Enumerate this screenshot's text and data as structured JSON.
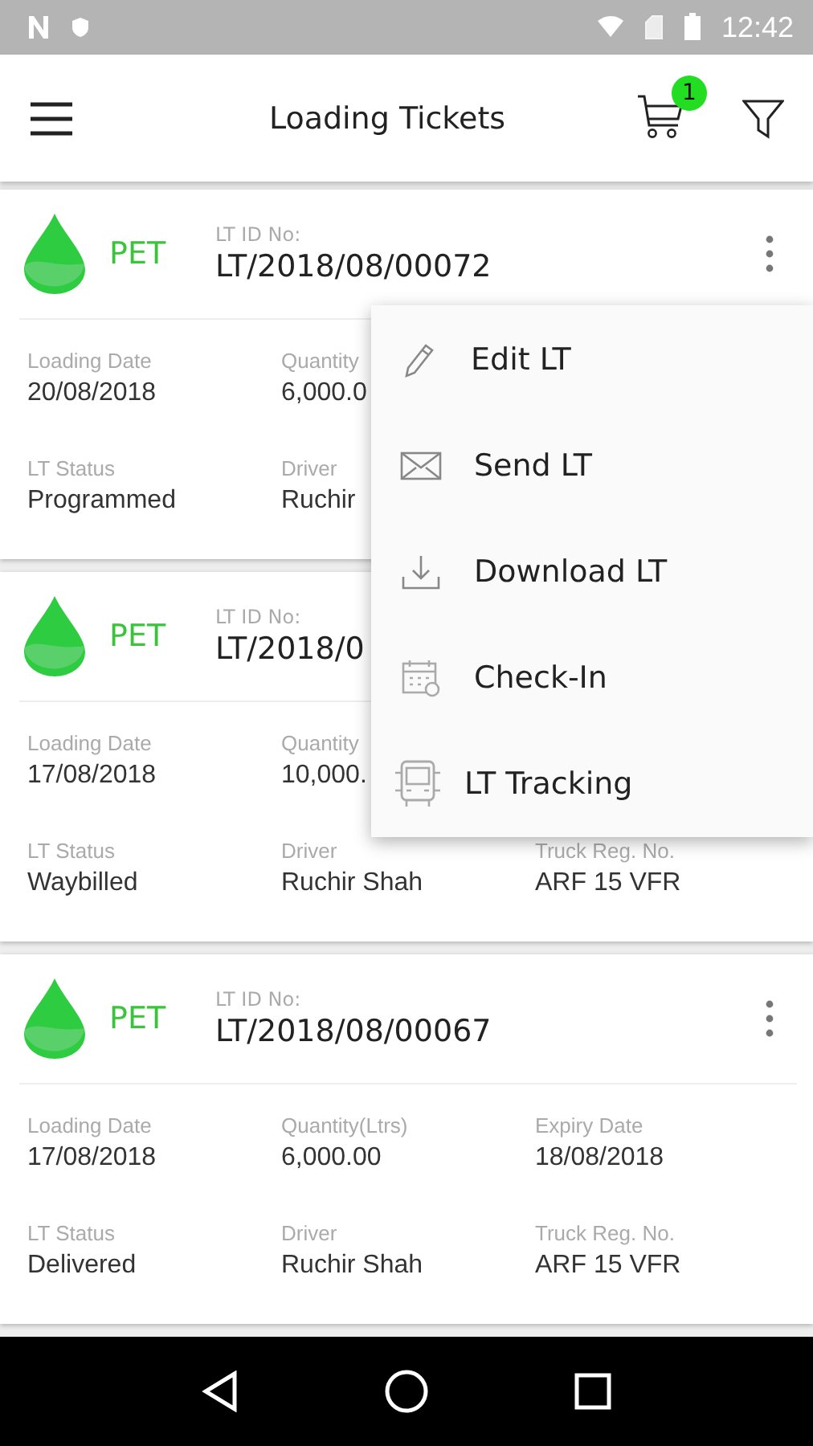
{
  "status_bar": {
    "time": "12:42"
  },
  "app_bar": {
    "title": "Loading Tickets",
    "cart_count": "1"
  },
  "cards": [
    {
      "product": "PET",
      "id_label": "LT ID No:",
      "id": "LT/2018/08/00072",
      "more_menu": true,
      "rows": [
        [
          {
            "label": "Loading Date",
            "value": "20/08/2018"
          },
          {
            "label": "Quantity",
            "value": "6,000.0"
          }
        ],
        [
          {
            "label": "LT Status",
            "value": "Programmed"
          },
          {
            "label": "Driver",
            "value": "Ruchir"
          }
        ]
      ]
    },
    {
      "product": "PET",
      "id_label": "LT ID No:",
      "id": "LT/2018/0",
      "rows": [
        [
          {
            "label": "Loading Date",
            "value": "17/08/2018"
          },
          {
            "label": "Quantity",
            "value": "10,000."
          }
        ],
        [
          {
            "label": "LT Status",
            "value": "Waybilled"
          },
          {
            "label": "Driver",
            "value": "Ruchir Shah"
          },
          {
            "label": "Truck Reg. No.",
            "value": "ARF 15 VFR"
          }
        ]
      ]
    },
    {
      "product": "PET",
      "id_label": "LT ID No:",
      "id": "LT/2018/08/00067",
      "more_menu": true,
      "rows": [
        [
          {
            "label": "Loading Date",
            "value": "17/08/2018"
          },
          {
            "label": "Quantity(Ltrs)",
            "value": "6,000.00"
          },
          {
            "label": "Expiry Date",
            "value": "18/08/2018"
          }
        ],
        [
          {
            "label": "LT Status",
            "value": "Delivered"
          },
          {
            "label": "Driver",
            "value": "Ruchir Shah"
          },
          {
            "label": "Truck Reg. No.",
            "value": "ARF 15 VFR"
          }
        ]
      ]
    }
  ],
  "menu": [
    {
      "kind": "edit",
      "label": "Edit LT"
    },
    {
      "kind": "send",
      "label": "Send LT"
    },
    {
      "kind": "download",
      "label": "Download LT"
    },
    {
      "kind": "checkin",
      "label": "Check-In"
    },
    {
      "kind": "tracking",
      "label": "LT Tracking"
    }
  ]
}
